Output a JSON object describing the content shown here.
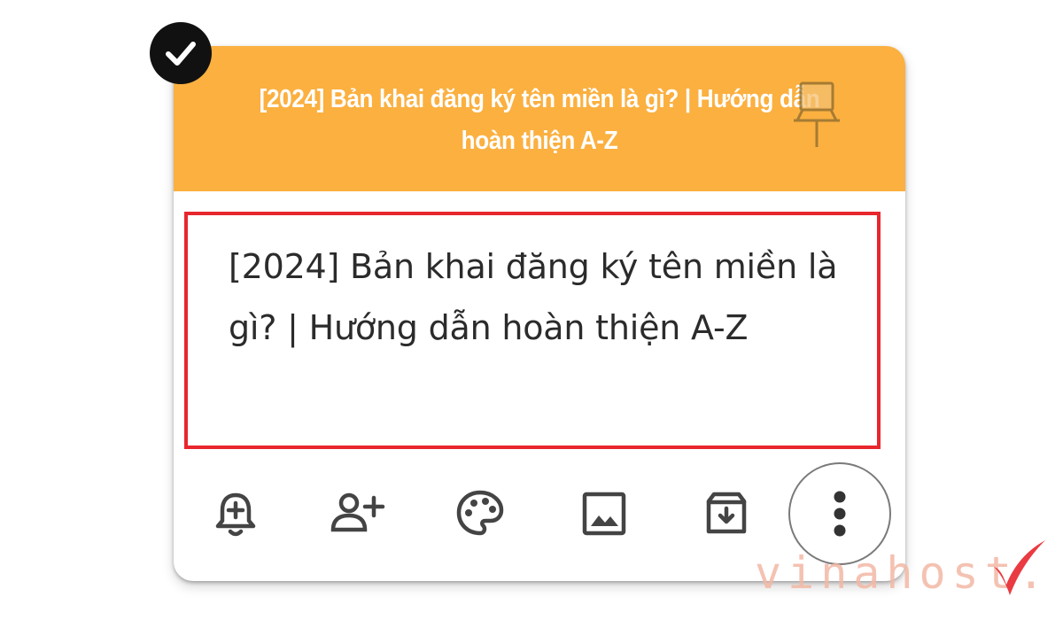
{
  "note": {
    "header_title": "[2024] Bản khai đăng ký tên miền là gì? | Hướng dẫn hoàn thiện A-Z",
    "header_color": "#fbb040",
    "body_text": "[2024] Bản khai đăng ký tên miền là gì? | Hướng dẫn hoàn thiện A-Z",
    "selected": true,
    "highlight_color": "#e8262d"
  },
  "icons": {
    "select": "check-icon",
    "pin": "pin-icon",
    "reminder": "bell-plus-icon",
    "collaborator": "person-add-icon",
    "color": "palette-icon",
    "image": "image-icon",
    "archive": "archive-icon",
    "more": "more-vert-icon"
  },
  "watermark": {
    "text": "vinahost."
  }
}
